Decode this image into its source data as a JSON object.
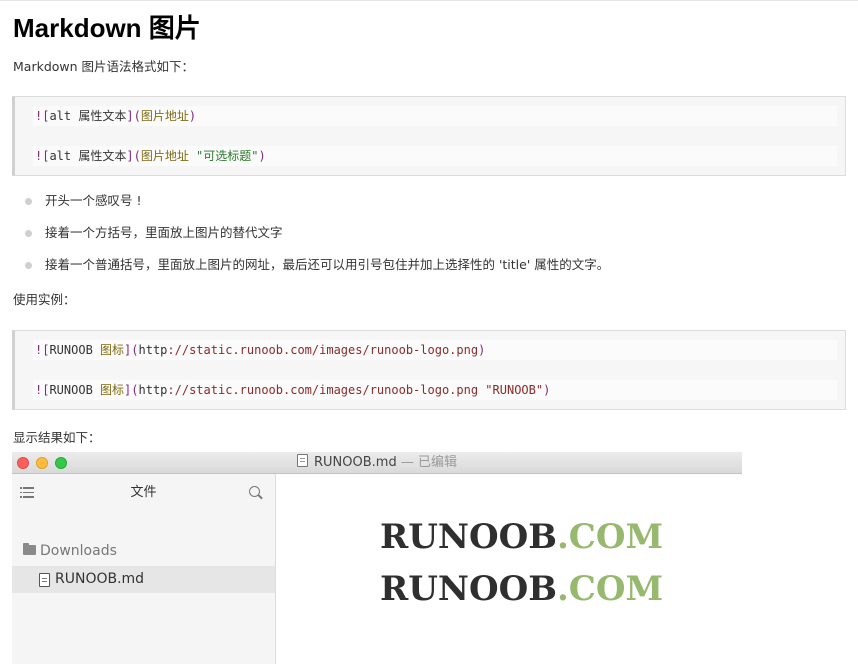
{
  "article": {
    "title": "Markdown 图片",
    "intro": "Markdown 图片语法格式如下：",
    "code1": {
      "line1": [
        "![",
        "alt 属性文本",
        "](",
        "图片地址",
        ")"
      ],
      "line2": [
        "![",
        "alt 属性文本",
        "](",
        "图片地址 ",
        "\"可选标题\"",
        ")"
      ]
    },
    "bullets": [
      "开头一个感叹号 !",
      "接着一个方括号，里面放上图片的替代文字",
      "接着一个普通括号，里面放上图片的网址，最后还可以用引号包住并加上选择性的 'title' 属性的文字。"
    ],
    "example_label": "使用实例：",
    "code2": {
      "line1": [
        "![",
        "RUNOOB ",
        "图标",
        "](",
        "http",
        "://static.runoob.com/images/runoob-logo.png",
        ")"
      ],
      "line2": [
        "![",
        "RUNOOB ",
        "图标",
        "](",
        "http",
        "://static.runoob.com/images/runoob-logo.png ",
        "\"RUNOOB\"",
        ")"
      ]
    },
    "result_label": "显示结果如下："
  },
  "window": {
    "title": "RUNOOB.md",
    "title_suffix": " — 已编辑",
    "sidebar": {
      "header": "文件",
      "folder": "Downloads",
      "file": "RUNOOB.md"
    },
    "logo": {
      "dark_text": "RUNOOB",
      "green_text": ".COM",
      "dark_color": "#2f2f2f",
      "green_color": "#96b96e"
    }
  }
}
